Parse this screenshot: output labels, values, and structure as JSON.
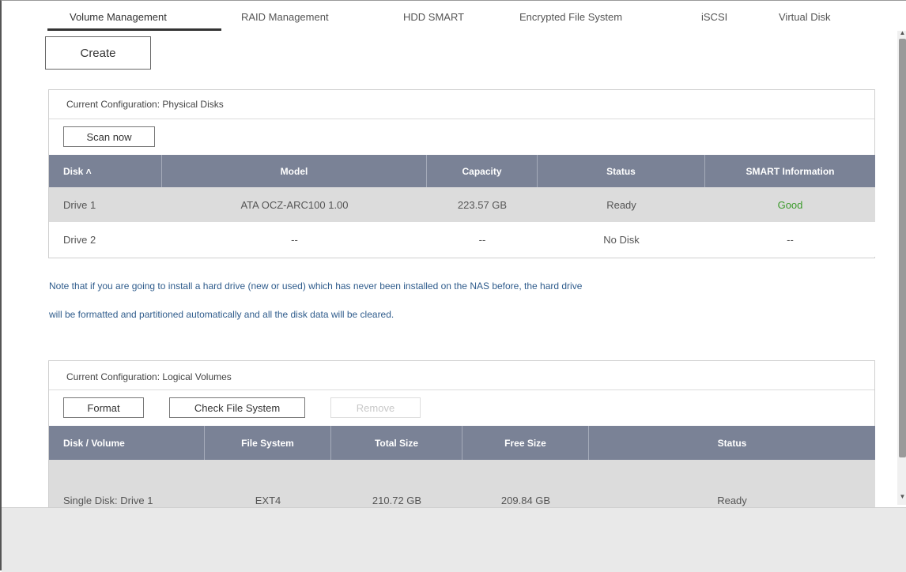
{
  "tabs": [
    {
      "label": "Volume Management"
    },
    {
      "label": "RAID Management"
    },
    {
      "label": "HDD SMART"
    },
    {
      "label": "Encrypted File System"
    },
    {
      "label": "iSCSI"
    },
    {
      "label": "Virtual Disk"
    }
  ],
  "create_label": "Create",
  "physical": {
    "title": "Current Configuration: Physical Disks",
    "scan_label": "Scan now",
    "columns": [
      "Disk ˄",
      "Model",
      "Capacity",
      "Status",
      "SMART Information"
    ],
    "rows": [
      [
        "Drive 1",
        "ATA OCZ-ARC100 1.00",
        "223.57 GB",
        "Ready",
        "Good"
      ],
      [
        "Drive 2",
        "--",
        "--",
        "No Disk",
        "--"
      ]
    ]
  },
  "note": {
    "line1": "Note that if you are going to install a hard drive (new or used) which has never been installed on the NAS before, the hard drive",
    "line2": "will be formatted and partitioned automatically and all the disk data will be cleared."
  },
  "logical": {
    "title": "Current Configuration: Logical Volumes",
    "format_label": "Format",
    "check_label": "Check File System",
    "remove_label": "Remove",
    "columns": [
      "Disk / Volume",
      "File System",
      "Total Size",
      "Free Size",
      "Status"
    ],
    "rows": [
      [
        "Single Disk: Drive 1",
        "EXT4",
        "210.72 GB",
        "209.84 GB",
        "Ready"
      ]
    ]
  },
  "colors": {
    "header": "#7a8296",
    "good": "#3a9a2a",
    "note": "#2f5c8c"
  }
}
